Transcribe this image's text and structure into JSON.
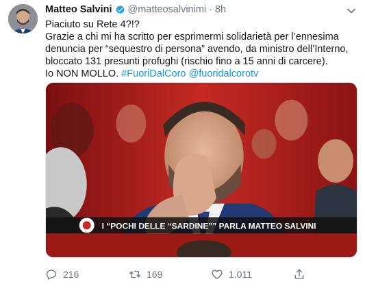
{
  "user": {
    "name": "Matteo Salvini",
    "handle": "@matteosalvinimi",
    "separator": "·",
    "time": "8h",
    "verified": true
  },
  "tweet": {
    "lines": [
      "Piaciuto su Rete 4?!?",
      "Grazie a chi mi ha scritto per esprimermi solidarietà per l’ennesima",
      "denuncia per “sequestro di persona” avendo, da ministro dell’Interno,",
      "bloccato 131 presunti profughi (rischio fino a 15 anni di carcere)."
    ],
    "last_line_text": "Io NON MOLLO.",
    "hashtag": "#FuoriDalCoro",
    "mention": "@fuoridalcorotv"
  },
  "media": {
    "banner_text": "I “POCHI DELLE “SARDINE”” PARLA MATTEO SALVINI"
  },
  "actions": {
    "reply_count": "216",
    "retweet_count": "169",
    "like_count": "1.011"
  },
  "colors": {
    "link": "#1b95e0",
    "muted": "#657786",
    "verified": "#1da1f2",
    "studio_red": "#b31d1d"
  },
  "icons": {
    "verified": "verified-badge-icon",
    "caret": "chevron-down-icon",
    "reply": "reply-icon",
    "retweet": "retweet-icon",
    "like": "heart-icon",
    "share": "share-icon"
  }
}
